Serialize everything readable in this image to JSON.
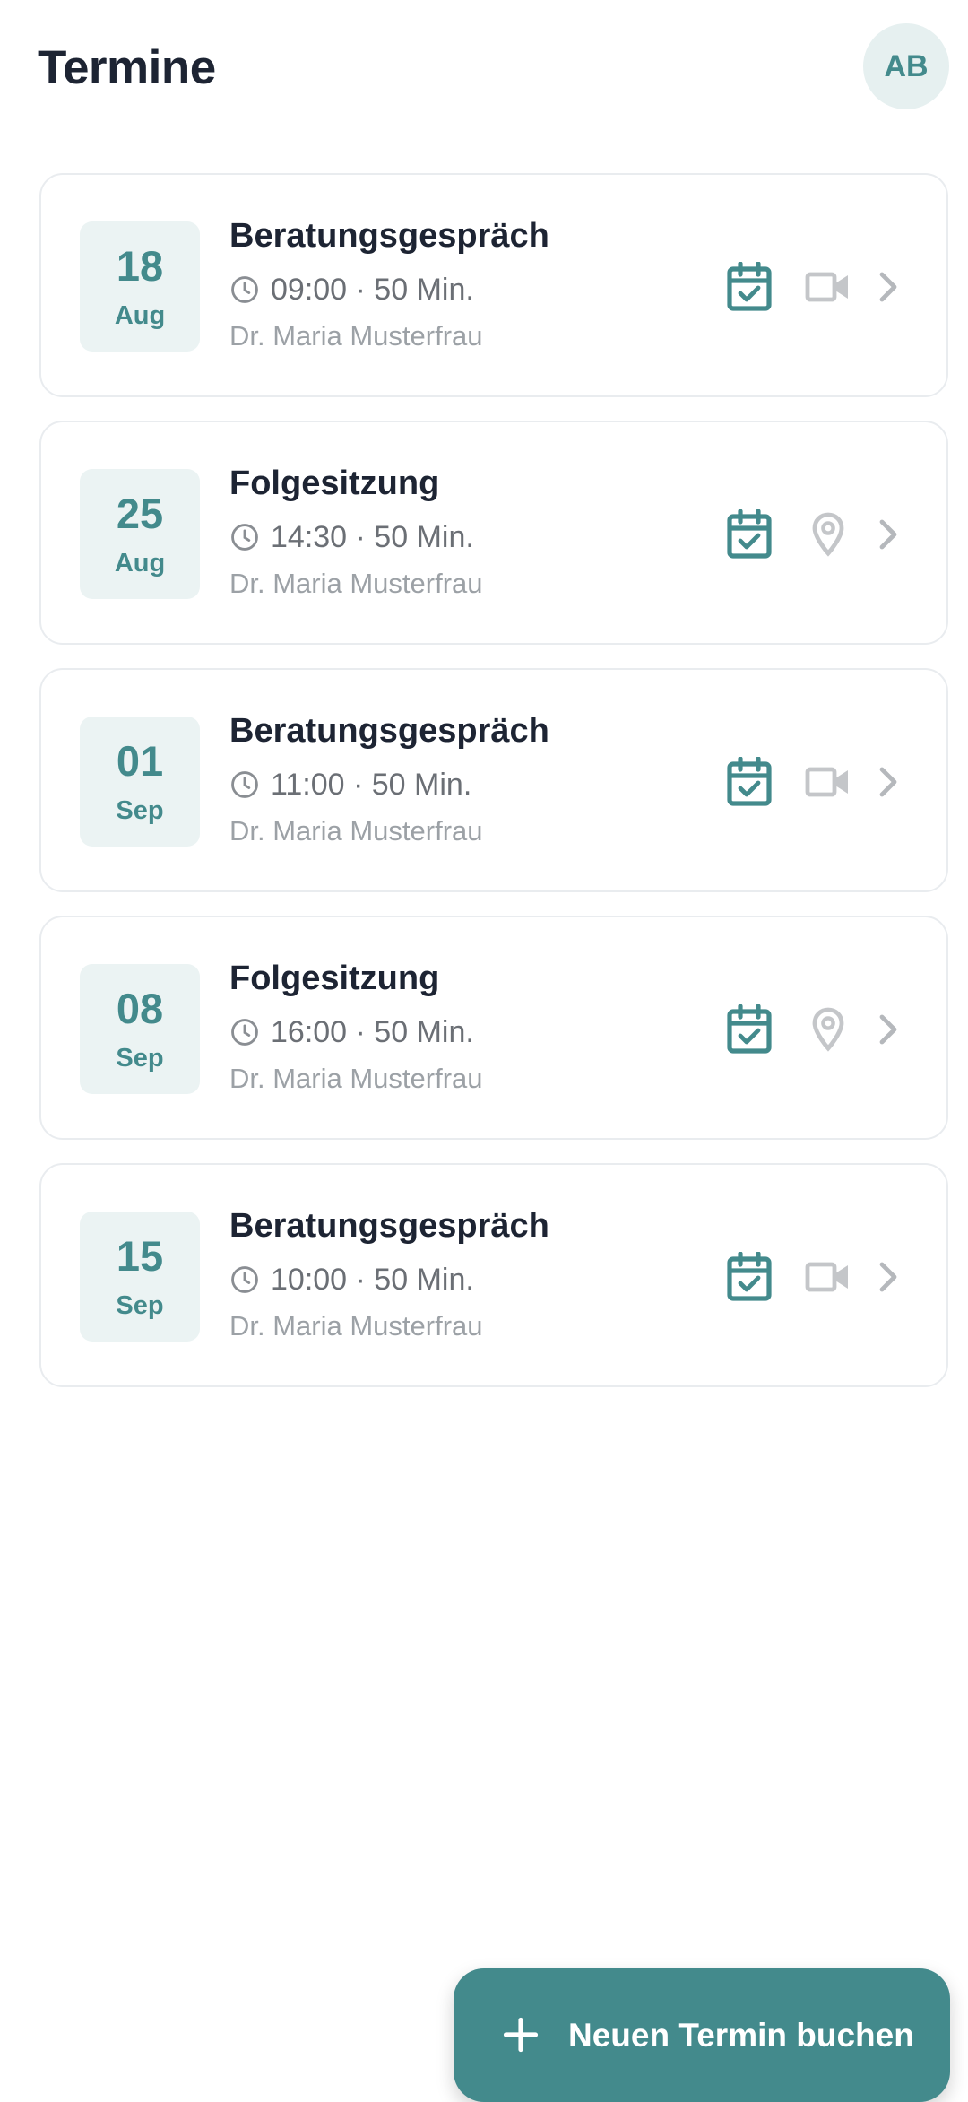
{
  "header": {
    "title": "Termine",
    "avatar_initials": "AB"
  },
  "appointments": [
    {
      "day": "18",
      "month": "Aug",
      "title": "Beratungsgespräch",
      "time": "09:00 · 50 Min.",
      "doctor": "Dr. Maria Musterfrau",
      "type_icon": "video-camera-icon"
    },
    {
      "day": "25",
      "month": "Aug",
      "title": "Folgesitzung",
      "time": "14:30 · 50 Min.",
      "doctor": "Dr. Maria Musterfrau",
      "type_icon": "location-pin-icon"
    },
    {
      "day": "01",
      "month": "Sep",
      "title": "Beratungsgespräch",
      "time": "11:00 · 50 Min.",
      "doctor": "Dr. Maria Musterfrau",
      "type_icon": "video-camera-icon"
    },
    {
      "day": "08",
      "month": "Sep",
      "title": "Folgesitzung",
      "time": "16:00 · 50 Min.",
      "doctor": "Dr. Maria Musterfrau",
      "type_icon": "location-pin-icon"
    },
    {
      "day": "15",
      "month": "Sep",
      "title": "Beratungsgespräch",
      "time": "10:00 · 50 Min.",
      "doctor": "Dr. Maria Musterfrau",
      "type_icon": "video-camera-icon"
    }
  ],
  "fab": {
    "label": "Neuen Termin buchen",
    "icon": "plus-icon"
  },
  "colors": {
    "accent": "#438a8c",
    "accent_light": "#ebf3f3",
    "title_text": "#1d2433",
    "secondary_text": "#6b6f75",
    "muted_text": "#9ca1a6",
    "icon_gray": "#c4c6c9",
    "border": "#e9ecef"
  }
}
